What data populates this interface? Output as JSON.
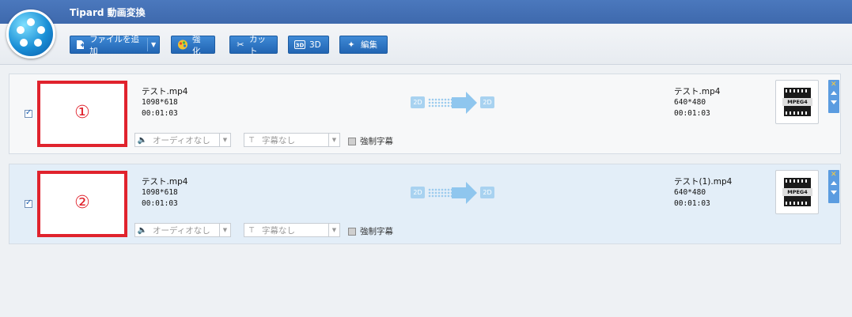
{
  "app": {
    "title": "Tipard 動画変換"
  },
  "toolbar": {
    "add_file": "ファイルを追加",
    "enhance": "強化",
    "cut": "カット",
    "three_d": "3D",
    "edit": "編集"
  },
  "rows": [
    {
      "marker": "①",
      "source": {
        "name": "テスト.mp4",
        "resolution": "1098*618",
        "duration": "00:01:03"
      },
      "output": {
        "name": "テスト.mp4",
        "resolution": "640*480",
        "duration": "00:01:03",
        "format": "MPEG4"
      },
      "convert_from": "2D",
      "convert_to": "2D",
      "audio": "オーディオなし",
      "subtitle": "字幕なし",
      "forced_subtitle": "強制字幕"
    },
    {
      "marker": "②",
      "source": {
        "name": "テスト.mp4",
        "resolution": "1098*618",
        "duration": "00:01:03"
      },
      "output": {
        "name": "テスト(1).mp4",
        "resolution": "640*480",
        "duration": "00:01:03",
        "format": "MPEG4"
      },
      "convert_from": "2D",
      "convert_to": "2D",
      "audio": "オーディオなし",
      "subtitle": "字幕なし",
      "forced_subtitle": "強制字幕"
    }
  ],
  "colors": {
    "titlebar": "#4171b6",
    "button": "#2d74c4",
    "highlight": "#e0232d",
    "selected_row": "#e3eef8"
  }
}
